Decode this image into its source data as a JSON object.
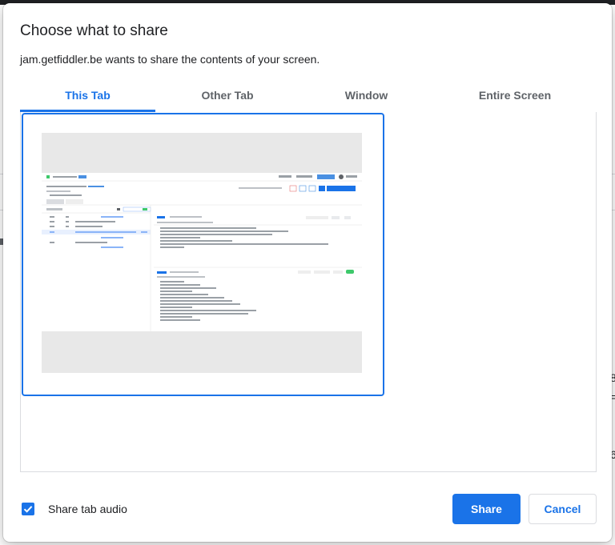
{
  "dialog": {
    "title": "Choose what to share",
    "subtitle": "jam.getfiddler.be wants to share the contents of your screen."
  },
  "tabs": [
    {
      "label": "This Tab",
      "active": true
    },
    {
      "label": "Other Tab",
      "active": false
    },
    {
      "label": "Window",
      "active": false
    },
    {
      "label": "Entire Screen",
      "active": false
    }
  ],
  "footer": {
    "audio_checkbox_label": "Share tab audio",
    "audio_checked": true,
    "share_label": "Share",
    "cancel_label": "Cancel"
  },
  "background": {
    "glyph_a": "8",
    "glyph_b": "=",
    "glyph_c": "6"
  },
  "colors": {
    "accent": "#1a73e8",
    "thumb_backdrop": "#e8e8e8",
    "thumb_green": "#3ec96b"
  }
}
